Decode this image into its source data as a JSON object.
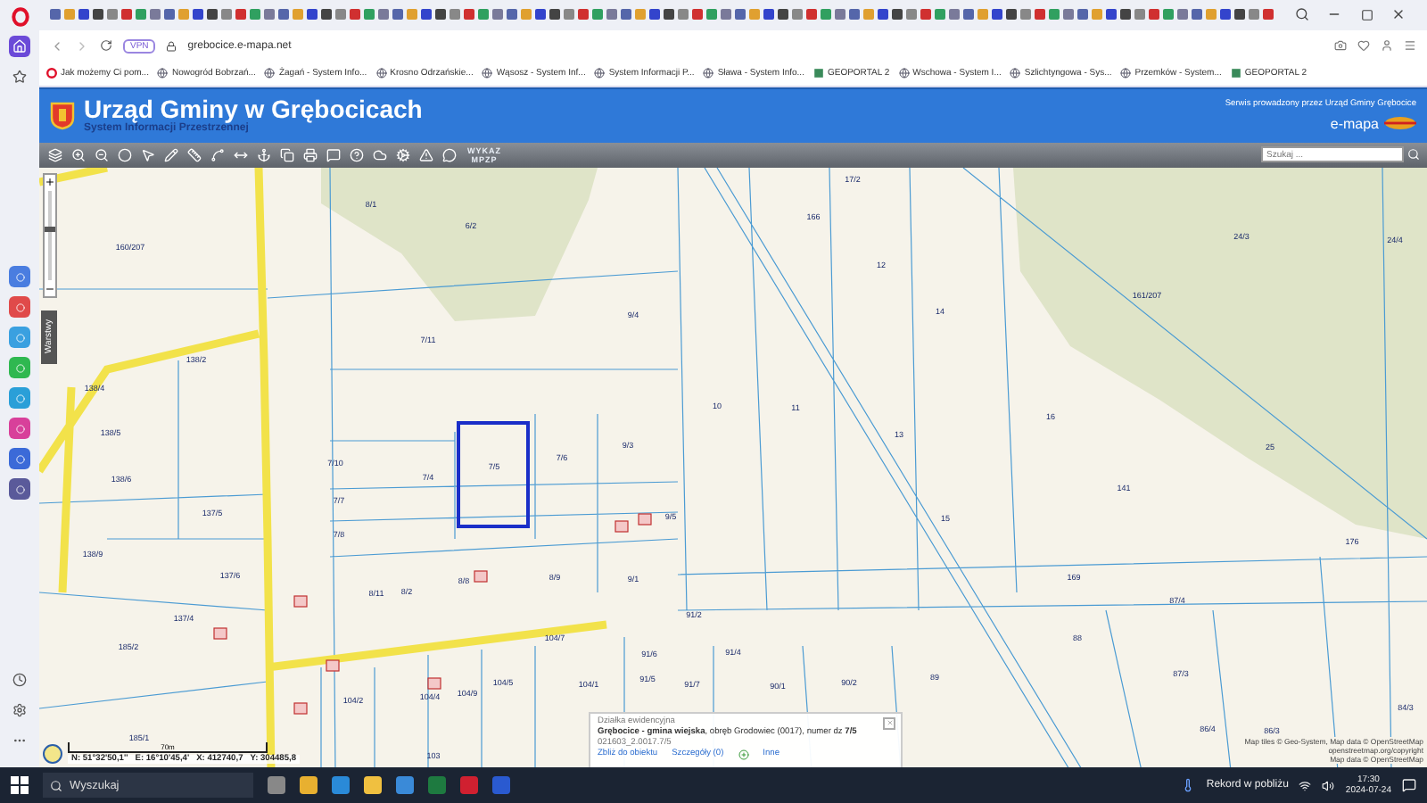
{
  "browser": {
    "url": "grebocice.e-mapa.net",
    "vpn_badge": "VPN",
    "bookmarks": [
      {
        "label": "Jak możemy Ci pom...",
        "kind": "opera"
      },
      {
        "label": "Nowogród Bobrzań...",
        "kind": "globe"
      },
      {
        "label": "Żagań - System Info...",
        "kind": "globe"
      },
      {
        "label": "Krosno Odrzańskie...",
        "kind": "globe"
      },
      {
        "label": "Wąsosz - System Inf...",
        "kind": "globe"
      },
      {
        "label": "System Informacji P...",
        "kind": "globe"
      },
      {
        "label": "Sława - System Info...",
        "kind": "globe"
      },
      {
        "label": "GEOPORTAL 2",
        "kind": "geoportal"
      },
      {
        "label": "Wschowa - System I...",
        "kind": "globe"
      },
      {
        "label": "Szlichtyngowa - Sys...",
        "kind": "globe"
      },
      {
        "label": "Przemków - System...",
        "kind": "globe"
      },
      {
        "label": "GEOPORTAL 2",
        "kind": "geoportal"
      }
    ]
  },
  "header": {
    "title": "Urząd Gminy w Grębocicach",
    "subtitle": "System Informacji Przestrzennej",
    "operator_note": "Serwis prowadzony przez Urząd Gminy Grębocice",
    "brand": "e-mapa"
  },
  "toolbar": {
    "mpzp_button": [
      "WYKAZ",
      "MPZP"
    ],
    "search": {
      "placeholder": "Szukaj ..."
    }
  },
  "map": {
    "layers_tab": "Warstwy",
    "zoom": {
      "level": 0.6
    },
    "parcel_labels": [
      "8/1",
      "6/2",
      "17/2",
      "166",
      "160/207",
      "12",
      "24/3",
      "24/4",
      "9/4",
      "14",
      "161/207",
      "7/11",
      "138/2",
      "138/4",
      "10",
      "11",
      "16",
      "138/5",
      "7/10",
      "7/6",
      "9/3",
      "13",
      "25",
      "138/6",
      "7/4",
      "7/5",
      "141",
      "7/7",
      "137/5",
      "9/5",
      "15",
      "138/9",
      "7/8",
      "176",
      "137/6",
      "169",
      "8/11",
      "8/2",
      "8/8",
      "8/9",
      "9/1",
      "87/4",
      "137/4",
      "91/2",
      "88",
      "185/2",
      "104/7",
      "91/6",
      "91/4",
      "90/1",
      "90/2",
      "89",
      "87/3",
      "104/2",
      "104/4",
      "104/9",
      "104/5",
      "104/1",
      "91/5",
      "91/7",
      "86/4",
      "86/3",
      "185/1",
      "103",
      "84/3"
    ],
    "popup": {
      "heading": "Działka ewidencyjna",
      "description": "**Grębocice - gmina wiejska**, obręb Grodowiec (0017), numer dz **7/5**",
      "identifier": "021603_2.0017.7/5",
      "links": [
        "Zbliż do obiektu",
        "Szczegóły (0)",
        "Inne"
      ]
    },
    "scale": "70m",
    "coordinates": [
      "N: 51°32'50,1''",
      "E: 16°10'45,4'",
      "X: 412740,7",
      "Y: 304485,8"
    ],
    "attribution": [
      "Map tiles © Geo-System, Map data © OpenStreetMap",
      "openstreetmap.org/copyright",
      "Map data © OpenStreetMap"
    ]
  },
  "taskbar": {
    "search_placeholder": "Wyszukaj",
    "weather": "Rekord w pobliżu",
    "time": "17:30",
    "date": "2024-07-24"
  }
}
